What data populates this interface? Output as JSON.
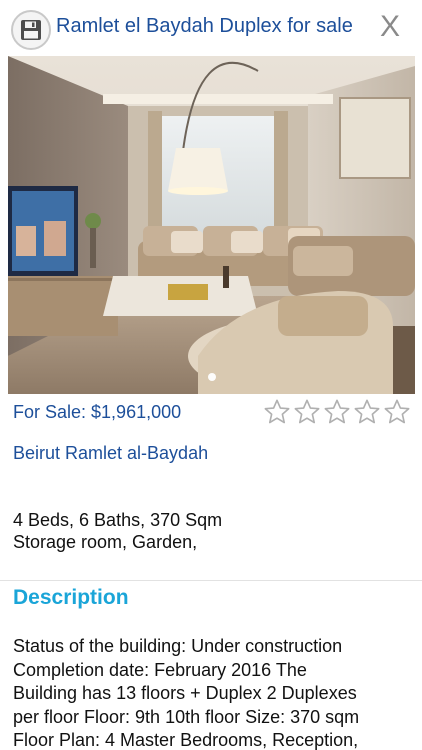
{
  "header": {
    "title": "Ramlet el Baydah Duplex for sale",
    "close_label": "X"
  },
  "listing": {
    "price": "For Sale: $1,961,000",
    "location": "Beirut Ramlet al-Baydah",
    "features_line1": "4 Beds, 6 Baths, 370 Sqm",
    "features_line2": "Storage room, Garden,",
    "rating_stars": 5,
    "rating_filled": 0
  },
  "gallery": {
    "image_count_dots": 1,
    "current_index": 0
  },
  "description": {
    "heading": "Description",
    "line1": "Status of the building: Under construction",
    "line2": "Completion date: February 2016 The",
    "line3": "Building has 13 floors + Duplex 2 Duplexes",
    "line4": "per floor Floor: 9th 10th floor Size: 370 sqm",
    "line5": "Floor Plan: 4 Master Bedrooms, Reception,"
  },
  "colors": {
    "accent_blue": "#1d4f9a",
    "heading_cyan": "#1aa5d8"
  },
  "icons": {
    "save": "floppy-disk-icon",
    "star": "star-outline-icon"
  }
}
